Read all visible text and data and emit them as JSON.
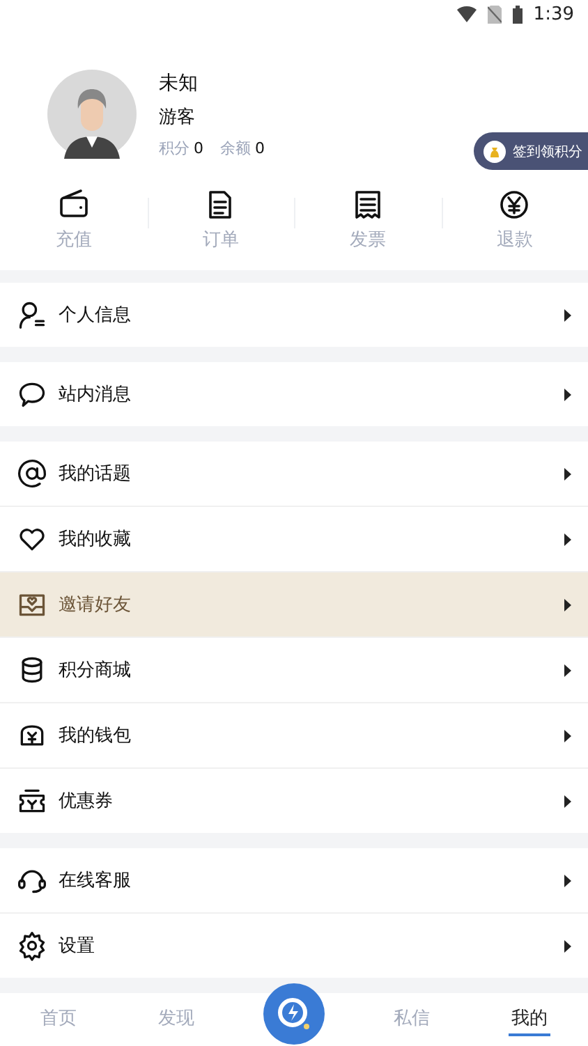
{
  "status_bar": {
    "time": "1:39"
  },
  "profile": {
    "name": "未知",
    "role": "游客",
    "stats": [
      {
        "label": "积分",
        "value": "0"
      },
      {
        "label": "余额",
        "value": "0"
      }
    ],
    "checkin_button": "签到领积分"
  },
  "quick_actions": [
    {
      "kind": "wallet",
      "label": "充值"
    },
    {
      "kind": "document",
      "label": "订单"
    },
    {
      "kind": "receipt",
      "label": "发票"
    },
    {
      "kind": "yen",
      "label": "退款"
    }
  ],
  "menu_groups": [
    [
      {
        "kind": "user",
        "label": "个人信息",
        "selected": false
      }
    ],
    [
      {
        "kind": "chat",
        "label": "站内消息",
        "selected": false
      }
    ],
    [
      {
        "kind": "at",
        "label": "我的话题",
        "selected": false
      },
      {
        "kind": "heart",
        "label": "我的收藏",
        "selected": false
      },
      {
        "kind": "invite",
        "label": "邀请好友",
        "selected": true
      },
      {
        "kind": "coins",
        "label": "积分商城",
        "selected": false
      },
      {
        "kind": "purse",
        "label": "我的钱包",
        "selected": false
      },
      {
        "kind": "coupon",
        "label": "优惠券",
        "selected": false
      }
    ],
    [
      {
        "kind": "headset",
        "label": "在线客服",
        "selected": false
      },
      {
        "kind": "gear",
        "label": "设置",
        "selected": false
      }
    ]
  ],
  "bottom_nav": [
    {
      "kind": "text",
      "label": "首页",
      "selected": false
    },
    {
      "kind": "text",
      "label": "发现",
      "selected": false
    },
    {
      "kind": "center",
      "selected": false
    },
    {
      "kind": "text",
      "label": "私信",
      "selected": false
    },
    {
      "kind": "text",
      "label": "我的",
      "selected": true
    }
  ]
}
